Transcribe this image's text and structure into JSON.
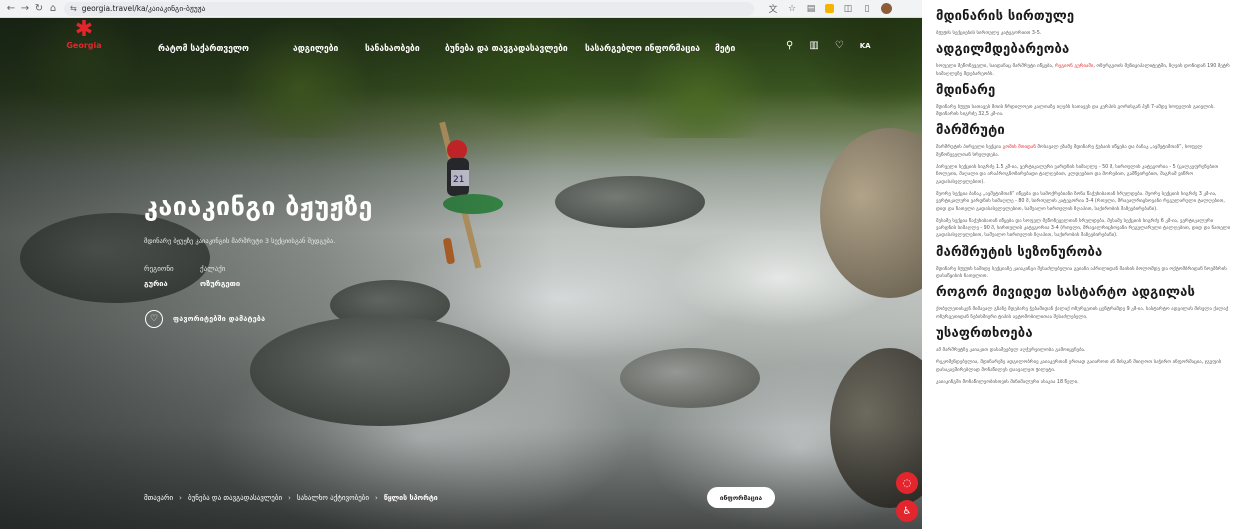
{
  "browser": {
    "url": "georgia.travel/ka/კაიაკინგი-ბჟუჟა",
    "nav_icons": [
      "back-icon",
      "forward-icon",
      "reload-icon",
      "home-icon"
    ]
  },
  "site": {
    "logo_text": "Georgia",
    "nav": [
      "რატომ საქართველო",
      "ადგილები",
      "სანახაობები",
      "ბუნება და თავგადასავლები",
      "სასარგებლო ინფორმაცია",
      "მეტი"
    ],
    "lang": "KA"
  },
  "hero": {
    "title": "კაიაკინგი ბჟუჟზე",
    "subtitle": "მდინარე ბჟუჟზე კაიაკინგის მარშრუტი 3 სექციისგან შედგება.",
    "region_label": "რეგიონი",
    "region_value": "გურია",
    "city_label": "ქალაქი",
    "city_value": "ოზურგეთი",
    "favorite_label": "ფავორიტებში დამატება"
  },
  "breadcrumbs": [
    "მთავარი",
    "ბუნება და თავგადასავლები",
    "სახალხო აქტივობები",
    "წყლის სპორტი"
  ],
  "info_button": "ინფორმაცია",
  "colors": {
    "brand_red": "#e4262c"
  },
  "article": {
    "sections": [
      {
        "heading": "მდინარის სირთულე",
        "paragraphs": [
          {
            "text": "ბჟუჟის სექციების სირთულე კატეგორიით 3-5."
          }
        ]
      },
      {
        "heading": "ადგილმდებარეობა",
        "paragraphs": [
          {
            "before": "სოფელი მეწონეველი, საიდანაც მარშრუტი იწყება, ",
            "link": "რეგიონ გურიაში",
            "after": ", ოზურგეთის მუნიციპალიტეტში, ზღვის დონიდან 190 მეტრ სიმაღლეზე მდებარეობს."
          }
        ]
      },
      {
        "heading": "მდინარე",
        "paragraphs": [
          {
            "text": "მდინარე ბჟუჟი სათავეს მთის ჩრდილოეთ კალთაზე იღებს სათავეს და კერპის გორისგან ჰენ 7-ამდე სოფელის გაივლის. მდინარის სიგრძე 32,5 კმ-ია."
          }
        ]
      },
      {
        "heading": "მარშრუტი",
        "paragraphs": [
          {
            "before": "მარშრუტის პირველი სექცია ",
            "link": "გომის მთიდან",
            "after": " მოსავალ ეზამე მდინარე ჭუბაის იწყება და ბანაკ „ავშეტიმთან“, სოფელ მეწონეველთან სრულდება."
          },
          {
            "text": "პირველი სექციის სიგრძე 1.5 კმ-ია, ვერტიკალური ვარდნის სიმაღლე - 50 მ, სირთულის კატეგორია - 5 (ცალკეფრენებით ჩოლეთი, მაღალი და არაპროგნოზირებადი ტალღებით, კლდეებით და მორებით, გამწვირებით, მაგრამ ვიწრო გადასასვლელებით)."
          },
          {
            "text": "მეორე სექცია ბანაკ „ავშეტიმთან“ იწყება და სამოქრებიანი ზონა წაქუხიბათან სრულდება. მეორე სექციის სიგრძე 3 კმ-ია, ვერტიკალური ვარდნის სიმაღლე - 80 მ, სირთულის კატეგორია 3-4 (რთული, მრავალრიცხოვანი რეგულარული ტალღებით, დიდ და ნათელი გადასასვლელებით, საშუალო სირთულის ზღაპით, საქირობის შაზეებირებანი)."
          },
          {
            "text": "მესამე სექცია წაქუხიბათან იწყება და სოფელ მეწონეველთან სრულდება. მესამე სექციის სიგრძე 6 კმ-ია, ვერტიკალური ვარდნის სიმაღლე - 90 მ, სირთულის კატეგორია 3-4 (რთული, მრავალრიცხოვანი რეგულარული ტალღებით, დიდ და ნათელი გადასასვლელებით, საშუალო სირთულის ზღაპით, საქირობის შაზეებირებანი)."
          }
        ]
      },
      {
        "heading": "მარშრუტის სეზონურობა",
        "paragraphs": [
          {
            "text": "მდინარე ბჟუჟის საშიდე სექციაზე კაიაკინგი შესაძლებელია გვიანი აპრილიდან მაისის ბოლომდე და ოქტომბრიდან ნოემბრის დასაწყისის ჩათვლით."
          }
        ]
      },
      {
        "heading": "როგორ მივიდეთ სასტარტო ადგილას",
        "paragraphs": [
          {
            "text": "ქობულეთისკენ მიმავალ გზაზე მდებარე ჭებაშიდან ქალაქ ოზურგეთის ცენტრამდე 9 კმ-ია. სასტარტო ადგილას მისვლა ქალაქ ოზურგეთიდან ნებისმიერი ტიპის ავტომობილითაა შესაძლებელი."
          }
        ]
      },
      {
        "heading": "უსაფრთხოება",
        "paragraphs": [
          {
            "text": "ამ მარშრუტზე კაიაკით დასაშვებულ აღჭურვილობა გამოიყენება."
          },
          {
            "text": "რეკომენდებულია, მდინარეზე ადგილობრივ კაიაკერთან ერთად გაიაროთ ან მისგან მიიღოთ საჭირო ინფორმაცია, ჯგუფის დასაკავშირებლად მონაწილეს დაავალეთ ჟილეტი."
          },
          {
            "text": "კაიაკინგში მონაწილეობისთვის მინიმალური ასაკია 18 წელი."
          }
        ]
      }
    ]
  }
}
